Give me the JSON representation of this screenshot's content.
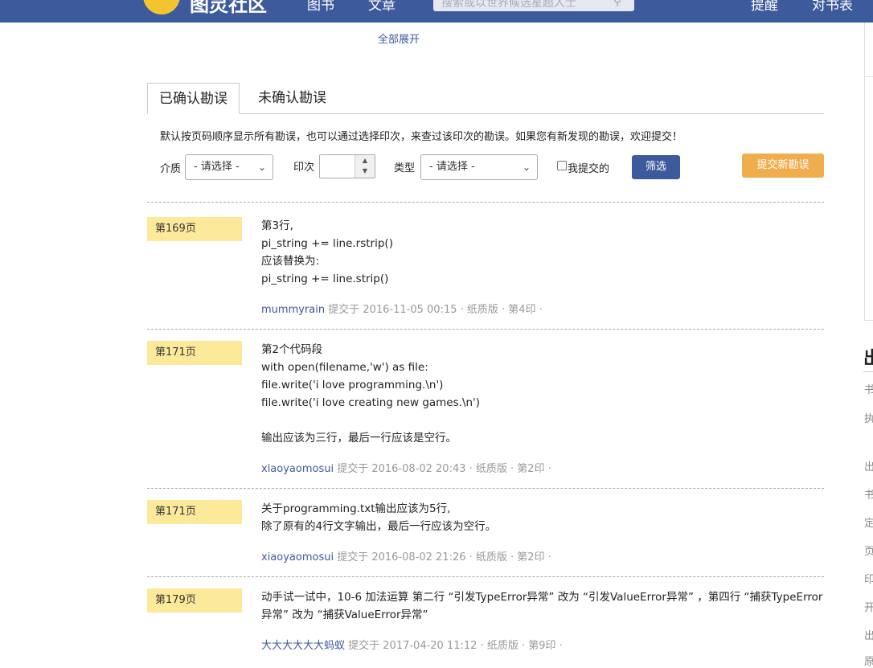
{
  "header": {
    "logo_text": "图灵社区",
    "nav": [
      "图书",
      "文章"
    ],
    "search_placeholder": "搜索或以世界候选星超人士",
    "right_links": [
      "提醒",
      "对书表"
    ]
  },
  "expand_all": "全部展开",
  "tabs": {
    "confirmed": "已确认勘误",
    "unconfirmed": "未确认勘误"
  },
  "intro": "默认按页码顺序显示所有勘误，也可以通过选择印次，来查过该印次的勘误。如果您有新发现的勘误，欢迎提交！",
  "filters": {
    "medium_label": "介质",
    "medium_value": "- 请选择 -",
    "printing_label": "印次",
    "type_label": "类型",
    "type_value": "- 请选择 -",
    "mine_label": "我提交的",
    "filter_button": "筛选",
    "submit_button": "提交新勘误"
  },
  "entries": [
    {
      "page": "第169页",
      "lines": [
        "第3行,",
        "pi_string += line.rstrip()",
        "应该替换为:",
        "pi_string += line.strip()"
      ],
      "user": "mummyrain",
      "meta": " 提交于 2016-11-05 00:15 · 纸质版 · 第4印 ·"
    },
    {
      "page": "第171页",
      "lines": [
        "第2个代码段",
        "with open(filename,'w') as file:",
        "file.write('i love programming.\\n')",
        "file.write('i love creating new games.\\n')",
        "",
        "输出应该为三行，最后一行应该是空行。"
      ],
      "user": "xiaoyaomosui",
      "meta": " 提交于 2016-08-02 20:43 · 纸质版 · 第2印 ·"
    },
    {
      "page": "第171页",
      "lines": [
        "关于programming.txt输出应该为5行,",
        "除了原有的4行文字输出，最后一行应该为空行。"
      ],
      "user": "xiaoyaomosui",
      "meta": " 提交于 2016-08-02 21:26 · 纸质版 · 第2印 ·"
    },
    {
      "page": "第179页",
      "lines": [
        "动手试一试中，10-6 加法运算 第二行 “引发TypeError异常” 改为 “引发ValueError异常” ，第四行 “捕获TypeError",
        "异常” 改为 “捕获ValueError异常”"
      ],
      "user": "大大大大大大蚂蚁",
      "meta": " 提交于 2017-04-20 11:12 · 纸质版 · 第9印 ·"
    }
  ],
  "sidebar": {
    "title": "出",
    "labels": [
      "书",
      "执",
      "出",
      "书",
      "定",
      "页",
      "印",
      "开",
      "出",
      "原"
    ]
  }
}
